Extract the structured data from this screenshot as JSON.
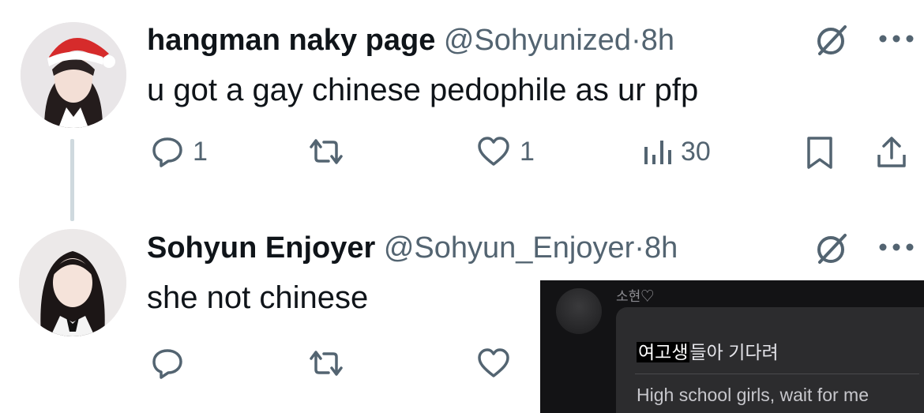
{
  "tweets": [
    {
      "display_name": "hangman naky page",
      "handle": "@Sohyunized",
      "dot": "·",
      "time": "8h",
      "text": "u got a gay chinese pedophile as ur pfp",
      "replies": "1",
      "likes": "1",
      "views": "30"
    },
    {
      "display_name": "Sohyun Enjoyer",
      "handle": "@Sohyun_Enjoyer",
      "dot": "·",
      "time": "8h",
      "text": "she not chinese"
    }
  ],
  "overlay": {
    "username": "소현♡",
    "highlighted": "여고생",
    "korean_rest": "들아 기다려",
    "translation": "High school girls, wait for me"
  },
  "colors": {
    "text": "#0f1419",
    "secondary": "#536471",
    "thread_line": "#cfd9de",
    "overlay_bg": "#131315"
  },
  "icons": [
    "reply-icon",
    "retweet-icon",
    "like-icon",
    "views-icon",
    "bookmark-icon",
    "share-icon",
    "grok-icon",
    "more-icon"
  ]
}
